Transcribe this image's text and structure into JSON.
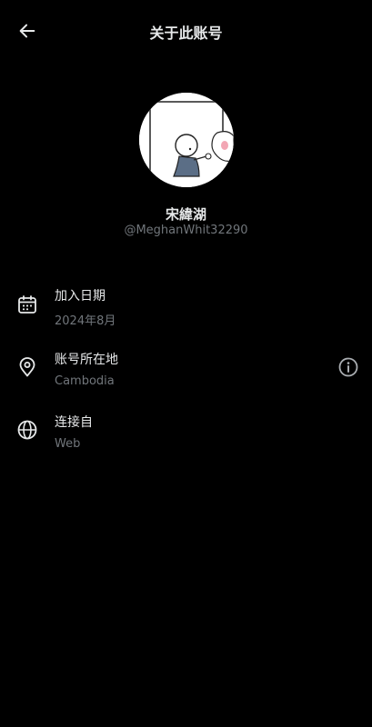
{
  "header": {
    "title": "关于此账号",
    "back_icon": "arrow-left-icon"
  },
  "profile": {
    "avatar_icon": "avatar-illustration",
    "display_name": "宋緯湖",
    "handle": "@MeghanWhit32290"
  },
  "details": [
    {
      "icon": "calendar-icon",
      "label": "加入日期",
      "value": "2024年8月"
    },
    {
      "icon": "location-pin-icon",
      "label": "账号所在地",
      "value": "Cambodia",
      "info_icon": "info-circle-icon"
    },
    {
      "icon": "globe-icon",
      "label": "连接自",
      "value": "Web"
    }
  ],
  "colors": {
    "background": "#000000",
    "primary_text": "#e7e9ea",
    "secondary_text": "#71767b"
  }
}
